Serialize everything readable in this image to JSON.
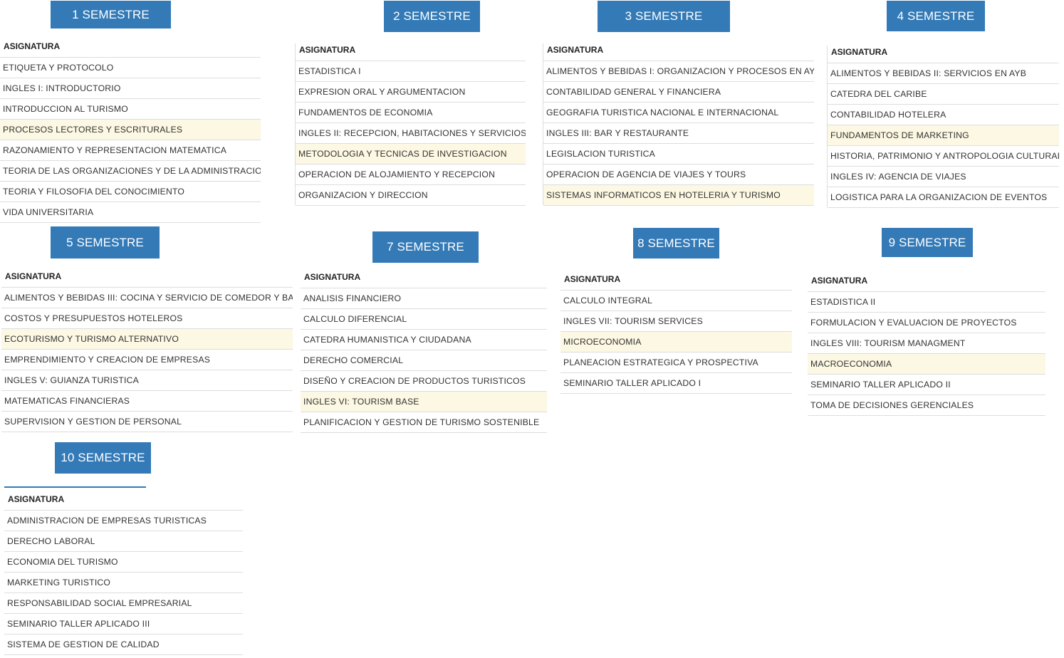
{
  "theme": {
    "badge_color": "#337ab7",
    "highlight_color": "#fcf8e3",
    "border_color": "#dddddd"
  },
  "semesters": [
    {
      "title": "1 SEMESTRE",
      "header": "ASIGNATURA",
      "highlighted_index": 3,
      "subjects": [
        "ETIQUETA Y PROTOCOLO",
        "INGLES I: INTRODUCTORIO",
        "INTRODUCCION AL TURISMO",
        "PROCESOS LECTORES Y ESCRITURALES",
        "RAZONAMIENTO Y REPRESENTACION MATEMATICA",
        "TEORIA DE LAS ORGANIZACIONES Y DE LA ADMINISTRACION",
        "TEORIA Y FILOSOFIA DEL CONOCIMIENTO",
        "VIDA UNIVERSITARIA"
      ]
    },
    {
      "title": "2 SEMESTRE",
      "header": "ASIGNATURA",
      "highlighted_index": 4,
      "subjects": [
        "ESTADISTICA I",
        "EXPRESION ORAL Y ARGUMENTACION",
        "FUNDAMENTOS DE ECONOMIA",
        "INGLES II: RECEPCION, HABITACIONES Y SERVICIOS",
        "METODOLOGIA Y TECNICAS DE INVESTIGACION",
        "OPERACION DE ALOJAMIENTO Y RECEPCION",
        "ORGANIZACION Y DIRECCION"
      ]
    },
    {
      "title": "3 SEMESTRE",
      "header": "ASIGNATURA",
      "highlighted_index": 6,
      "subjects": [
        "ALIMENTOS Y BEBIDAS I: ORGANIZACION Y PROCESOS EN AYB",
        "CONTABILIDAD GENERAL Y FINANCIERA",
        "GEOGRAFIA TURISTICA NACIONAL E INTERNACIONAL",
        "INGLES III: BAR Y RESTAURANTE",
        "LEGISLACION TURISTICA",
        "OPERACION DE AGENCIA DE VIAJES Y TOURS",
        "SISTEMAS INFORMATICOS EN HOTELERIA Y TURISMO"
      ]
    },
    {
      "title": "4 SEMESTRE",
      "header": "ASIGNATURA",
      "highlighted_index": 3,
      "subjects": [
        "ALIMENTOS Y BEBIDAS II: SERVICIOS EN AYB",
        "CATEDRA DEL CARIBE",
        "CONTABILIDAD HOTELERA",
        "FUNDAMENTOS DE MARKETING",
        "HISTORIA, PATRIMONIO Y ANTROPOLOGIA CULTURAL",
        "INGLES IV: AGENCIA DE VIAJES",
        "LOGISTICA PARA LA ORGANIZACION DE EVENTOS"
      ]
    },
    {
      "title": "5 SEMESTRE",
      "header": "ASIGNATURA",
      "highlighted_index": 2,
      "subjects": [
        "ALIMENTOS Y BEBIDAS III: COCINA Y SERVICIO DE COMEDOR Y BAR",
        "COSTOS Y PRESUPUESTOS HOTELEROS",
        "ECOTURISMO Y TURISMO ALTERNATIVO",
        "EMPRENDIMIENTO Y CREACION DE EMPRESAS",
        "INGLES V: GUIANZA TURISTICA",
        "MATEMATICAS FINANCIERAS",
        "SUPERVISION Y GESTION DE PERSONAL"
      ]
    },
    {
      "title": "7 SEMESTRE",
      "header": "ASIGNATURA",
      "highlighted_index": 5,
      "subjects": [
        "ANALISIS FINANCIERO",
        "CALCULO DIFERENCIAL",
        "CATEDRA HUMANISTICA Y CIUDADANA",
        "DERECHO COMERCIAL",
        "DISEÑO Y CREACION DE PRODUCTOS TURISTICOS",
        "INGLES VI: TOURISM BASE",
        "PLANIFICACION Y GESTION DE TURISMO SOSTENIBLE"
      ]
    },
    {
      "title": "8 SEMESTRE",
      "header": "ASIGNATURA",
      "highlighted_index": 2,
      "subjects": [
        "CALCULO INTEGRAL",
        "INGLES VII: TOURISM SERVICES",
        "MICROECONOMIA",
        "PLANEACION ESTRATEGICA Y PROSPECTIVA",
        "SEMINARIO TALLER APLICADO I"
      ]
    },
    {
      "title": "9 SEMESTRE",
      "header": "ASIGNATURA",
      "highlighted_index": 3,
      "subjects": [
        "ESTADISTICA II",
        "FORMULACION Y EVALUACION DE PROYECTOS",
        "INGLES VIII: TOURISM MANAGMENT",
        "MACROECONOMIA",
        "SEMINARIO TALLER APLICADO II",
        "TOMA DE DECISIONES GERENCIALES"
      ]
    },
    {
      "title": "10 SEMESTRE",
      "header": "ASIGNATURA",
      "highlighted_index": -1,
      "subjects": [
        "ADMINISTRACION DE EMPRESAS TURISTICAS",
        "DERECHO LABORAL",
        "ECONOMIA DEL TURISMO",
        "MARKETING TURISTICO",
        "RESPONSABILIDAD SOCIAL EMPRESARIAL",
        "SEMINARIO TALLER APLICADO III",
        "SISTEMA DE GESTION DE CALIDAD"
      ]
    }
  ]
}
